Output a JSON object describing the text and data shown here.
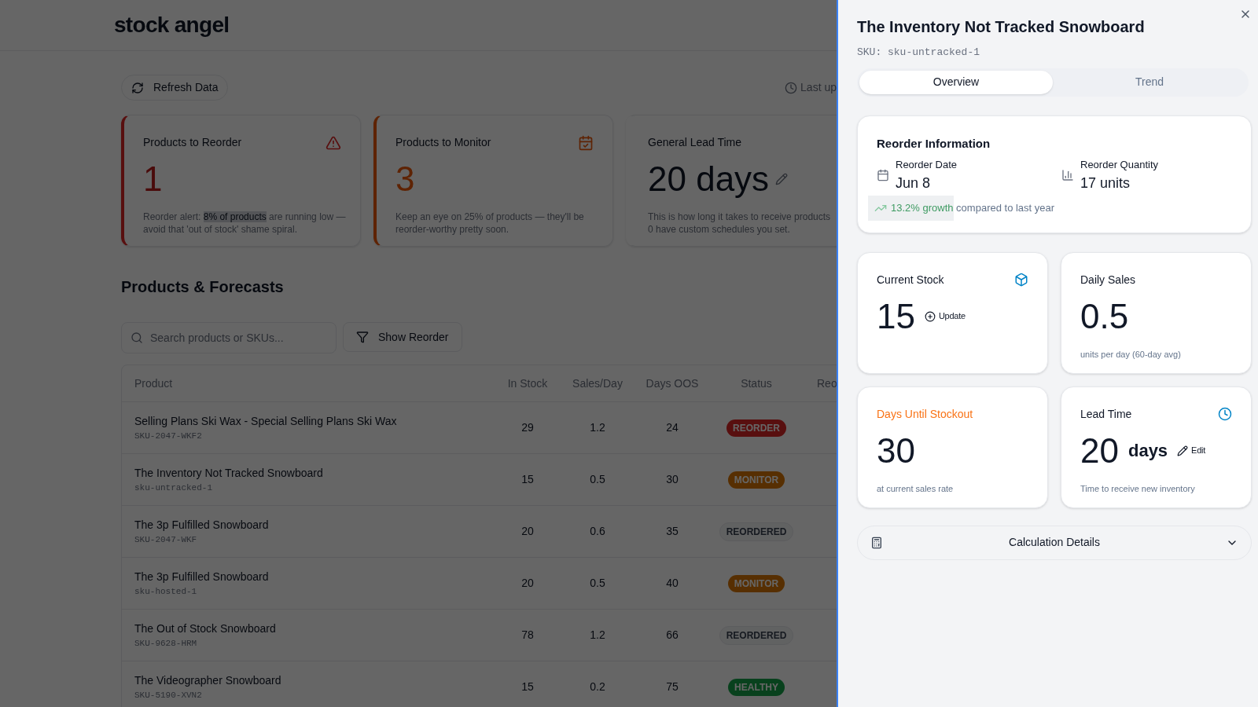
{
  "header": {
    "logo": "stock angel"
  },
  "toolbar": {
    "refresh": "Refresh Data",
    "last_updated": "Last up"
  },
  "summary_cards": [
    {
      "kind": "reorder",
      "title": "Products to Reorder",
      "value": "1",
      "before": "Reorder alert: ",
      "selected": "8% of products",
      "after": " are running low — avoid that 'out of stock' shame spiral."
    },
    {
      "kind": "monitor",
      "title": "Products to Monitor",
      "value": "3",
      "lines": [
        "Keep an eye on 25% of products — they'll be",
        "reorder-worthy pretty soon."
      ]
    },
    {
      "kind": "lead",
      "title": "General Lead Time",
      "value": "20 days",
      "lines": [
        "This is how long it takes to receive products",
        "0 have custom schedules you set."
      ]
    }
  ],
  "products": {
    "title": "Products & Forecasts",
    "search": {
      "placeholder": "Search products or SKUs..."
    },
    "filter": "Show Reorder",
    "columns": [
      "Product",
      "In Stock",
      "Sales/Day",
      "Days OOS",
      "Status",
      "Reo"
    ],
    "rows": [
      {
        "name": "Selling Plans Ski Wax - Special Selling Plans Ski Wax",
        "sku": "SKU-2047-WKF2",
        "in_stock": "29",
        "sales_day": "1.2",
        "days_oos": "24",
        "status": "REORDER",
        "kind": "reorder"
      },
      {
        "name": "The Inventory Not Tracked Snowboard",
        "sku": "sku-untracked-1",
        "in_stock": "15",
        "sales_day": "0.5",
        "days_oos": "30",
        "status": "MONITOR",
        "kind": "monitor"
      },
      {
        "name": "The 3p Fulfilled Snowboard",
        "sku": "SKU-2047-WKF",
        "in_stock": "20",
        "sales_day": "0.6",
        "days_oos": "35",
        "status": "REORDERED",
        "kind": "reordered"
      },
      {
        "name": "The 3p Fulfilled Snowboard",
        "sku": "sku-hosted-1",
        "in_stock": "20",
        "sales_day": "0.5",
        "days_oos": "40",
        "status": "MONITOR",
        "kind": "monitor"
      },
      {
        "name": "The Out of Stock Snowboard",
        "sku": "SKU-9628-HRM",
        "in_stock": "78",
        "sales_day": "1.2",
        "days_oos": "66",
        "status": "REORDERED",
        "kind": "reordered"
      },
      {
        "name": "The Videographer Snowboard",
        "sku": "SKU-5190-XVN2",
        "in_stock": "15",
        "sales_day": "0.2",
        "days_oos": "75",
        "status": "HEALTHY",
        "kind": "healthy"
      }
    ]
  },
  "panel": {
    "title": "The Inventory Not Tracked Snowboard",
    "sku": "SKU: sku-untracked-1",
    "tabs": [
      {
        "label": "Overview",
        "selected": true
      },
      {
        "label": "Trend",
        "selected": false
      }
    ],
    "reorder_info": {
      "title": "Reorder Information",
      "date_label": "Reorder Date",
      "date": "Jun 8",
      "quantity_label": "Reorder Quantity",
      "quantity": "17 units",
      "selected": "13.2% growth",
      "after": " compared to last year"
    },
    "stats": [
      {
        "kind": "stock",
        "title": "Current Stock",
        "value": "15",
        "action": "Update"
      },
      {
        "kind": "sales",
        "title": "Daily Sales",
        "value": "0.5",
        "note": "units per day (60-day avg)"
      },
      {
        "kind": "stockout",
        "title": "Days Until Stockout",
        "value": "30",
        "note": "at current sales rate"
      },
      {
        "kind": "lead",
        "title": "Lead Time",
        "value": "20",
        "unit": "days",
        "action": "Edit",
        "note": "Time to receive new inventory"
      }
    ],
    "calculation": {
      "label": "Calculation Details",
      "expanded": false
    }
  }
}
